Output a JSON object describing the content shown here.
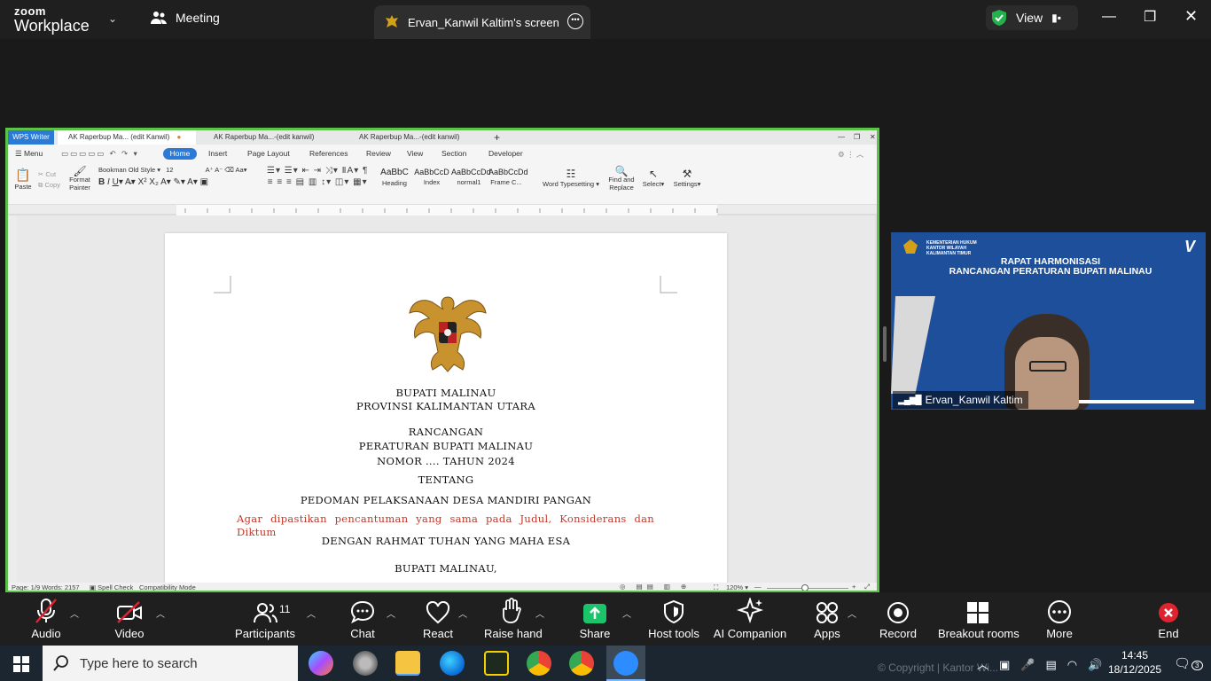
{
  "zoom": {
    "logo_top": "zoom",
    "logo_bottom": "Workplace",
    "meeting_label": "Meeting",
    "share_tab": "Ervan_Kanwil Kaltim's screen",
    "view_label": "View"
  },
  "wps": {
    "app_tab": "WPS Writer",
    "doc_tabs": [
      "AK Raperbup Ma... (edit Kanwil)",
      "AK Raperbup Ma...-(edit kanwil)",
      "AK Raperbup Ma...-(edit kanwil)"
    ],
    "menu_label": "Menu",
    "menu_tabs": [
      "Home",
      "Insert",
      "Page Layout",
      "References",
      "Review",
      "View",
      "Section",
      "Developer"
    ],
    "font_name": "Bookman Old Style",
    "font_size": "12",
    "paste_label": "Paste",
    "cut_label": "Cut",
    "copy_label": "Copy",
    "format_painter_label": "Format Painter",
    "styles": [
      {
        "sample": "AaBbC",
        "label": "Heading"
      },
      {
        "sample": "AaBbCcD",
        "label": "Index"
      },
      {
        "sample": "AaBbCcDd",
        "label": "normal1"
      },
      {
        "sample": "AaBbCcDd",
        "label": "Frame C..."
      }
    ],
    "word_typesetting": "Word Typesetting",
    "find_replace": "Find and Replace",
    "select_label": "Select",
    "settings_label": "Settings",
    "status_left": "Page: 1/9  Words: 2157",
    "spell_check": "Spell Check",
    "compat_mode": "Compatibility Mode",
    "zoom_level": "120%"
  },
  "document": {
    "line1": "BUPATI MALINAU",
    "line2": "PROVINSI KALIMANTAN UTARA",
    "line3": "RANCANGAN",
    "line4": "PERATURAN BUPATI MALINAU",
    "line5": "NOMOR .... TAHUN 2024",
    "line6": "TENTANG",
    "line7": "PEDOMAN PELAKSANAAN DESA MANDIRI PANGAN",
    "red_note": "Agar dipastikan pencantuman yang sama pada Judul, Konsiderans dan Diktum",
    "line8": "DENGAN RAHMAT TUHAN YANG MAHA ESA",
    "line9": "BUPATI MALINAU,"
  },
  "video": {
    "banner_small": "KEMENTERIAN HUKUM\nKANTOR WILAYAH\nKALIMANTAN TIMUR",
    "banner_title1": "RAPAT HARMONISASI",
    "banner_title2": "RANCANGAN PERATURAN BUPATI MALINAU",
    "participant_name": "Ervan_Kanwil Kaltim"
  },
  "toolbar": {
    "audio": "Audio",
    "video": "Video",
    "participants": "Participants",
    "participants_count": "11",
    "chat": "Chat",
    "react": "React",
    "raise_hand": "Raise hand",
    "share": "Share",
    "host_tools": "Host tools",
    "ai_companion": "AI Companion",
    "apps": "Apps",
    "record": "Record",
    "breakout_rooms": "Breakout rooms",
    "more": "More",
    "end": "End"
  },
  "taskbar": {
    "search_placeholder": "Type here to search",
    "copyright": "© Copyright | Kantor Wi...",
    "time": "14:45",
    "date": "18/12/2025",
    "notification_count": "3"
  },
  "colors": {
    "share_border": "#5cc34a",
    "wps_blue": "#2b7bd6",
    "share_green": "#1bc46b",
    "end_red": "#e0242f",
    "note_red": "#c0392b"
  }
}
